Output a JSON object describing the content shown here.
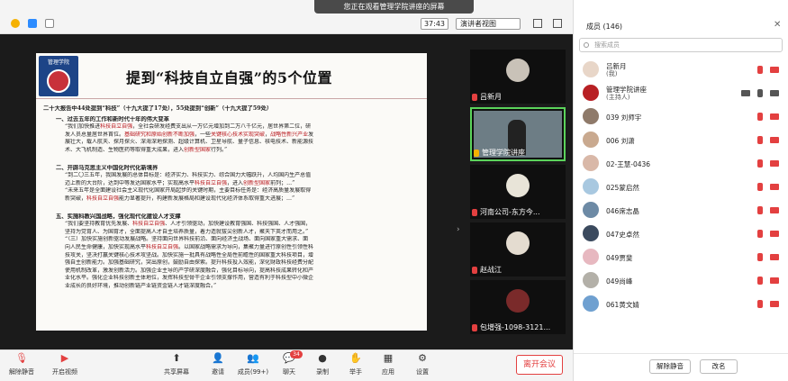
{
  "banner": "您正在观看管理学院讲座的屏幕",
  "topbar": {
    "timer": "37:43",
    "speaker_view": "演讲者视图"
  },
  "slide": {
    "logo_text": "管理学院",
    "title": "提到“科技自立自强”的5个位置",
    "lines": [
      {
        "cls": "sec",
        "text": "二十大报告中44处提到“科技”（十九大提了17处），55处提到“创新”（十九大提了59处）"
      },
      {
        "cls": "sec ind",
        "text": "一、过去五年的工作和新时代十年的伟大变革"
      },
      {
        "cls": "ind2",
        "text": "“我们加快推进科技自立自强，全社会研发经费支出从一万亿元增加到二万八千亿元，居世界第二位，研"
      },
      {
        "cls": "ind2",
        "text": "发人员总量居世界首位。基础研究和原始创新不断加强，一些关键核心技术实现突破，战略性新兴产业发"
      },
      {
        "cls": "ind2",
        "text": "展壮大，载人航天、探月探火、深海深地探测、超级计算机、卫星导航、量子信息、核电技术、新能源技"
      },
      {
        "cls": "ind2",
        "text": "术、大飞机制造、生物医药等取得重大成果，进入创新型国家行列。”"
      },
      {
        "cls": "gap",
        "text": ""
      },
      {
        "cls": "sec ind",
        "text": "二、开辟马克思主义中国化时代化新境界"
      },
      {
        "cls": "ind2",
        "text": "“到二〇三五年，我国发展的总体目标是：经济实力、科技实力、综合国力大幅跃升，人均国内生产总值"
      },
      {
        "cls": "ind2",
        "text": "迈上新的大台阶，达到中等发达国家水平；实现高水平科技自立自强，进入创新型国家前列；…”"
      },
      {
        "cls": "ind2",
        "text": "“未来五年是全面建设社会主义现代化国家开局起步的关键时期，主要目标任务是：经济高质量发展取得"
      },
      {
        "cls": "ind2",
        "text": "新突破，科技自立自强能力显著提升，构建新发展格局和建设现代化经济体系取得重大进展；…”"
      },
      {
        "cls": "gap",
        "text": ""
      },
      {
        "cls": "sec ind",
        "text": "五、实施科教兴国战略，强化现代化建设人才支撑"
      },
      {
        "cls": "ind2",
        "text": "“我们要坚持教育优先发展、科技自立自强、人才引领驱动，加快建设教育强国、科技强国、人才强国，"
      },
      {
        "cls": "ind2",
        "text": "坚持为党育人、为国育才，全面提高人才自主培养质量，着力造就拔尖创新人才，聚天下英才而用之。”"
      },
      {
        "cls": "ind2",
        "text": "“（三）加快实施创新驱动发展战略。坚持面向世界科技前沿、面向经济主战场、面向国家重大需求、面"
      },
      {
        "cls": "ind2",
        "text": "向人民生命健康，加快实现高水平科技自立自强。以国家战略需求为导向，集聚力量进行原创性引领性科"
      },
      {
        "cls": "ind2",
        "text": "技攻关，坚决打赢关键核心技术攻坚战。加快实施一批具有战略性全局性前瞻性的国家重大科技项目，增"
      },
      {
        "cls": "ind2",
        "text": "强自主创新能力。加强基础研究，突出原创，鼓励自由探索。提升科技投入效能，深化财政科技经费分配"
      },
      {
        "cls": "ind2",
        "text": "使用机制改革，激发创新活力。加强企业主导的产学研深度融合，强化目标导向，提高科技成果转化和产"
      },
      {
        "cls": "ind2",
        "text": "业化水平。强化企业科技创新主体地位，发挥科技型骨干企业引领支撑作用，营造有利于科技型中小微企"
      },
      {
        "cls": "ind2",
        "text": "业成长的良好环境，推动创新链产业链资金链人才链深度融合。”"
      }
    ]
  },
  "video_tiles": [
    {
      "name": "吕新月"
    },
    {
      "name": "管理学院讲座"
    },
    {
      "name": "河南公司-东方今..."
    },
    {
      "name": "赵战江"
    },
    {
      "name": "包增强-1098-3121..."
    }
  ],
  "toolbar": {
    "mute": "解除静音",
    "video": "开启视频",
    "share": "共享屏幕",
    "invite": "邀请",
    "participants": "成员(99+)",
    "chat": "聊天",
    "chat_badge": "34",
    "record": "录制",
    "raise_hand": "举手",
    "apps": "应用",
    "settings": "设置",
    "leave": "离开会议"
  },
  "panel": {
    "title": "成员 (146)",
    "search_placeholder": "搜索成员",
    "participants": [
      {
        "name": "吕新月",
        "sub": "(我)",
        "color": "#e8d6c8"
      },
      {
        "name": "管理学院讲座",
        "sub": "(主持人)",
        "color": "#b82024"
      },
      {
        "name": "039 刘师宇",
        "sub": "",
        "color": "#8f7a6a"
      },
      {
        "name": "006 刘潇",
        "sub": "",
        "color": "#c9a98f"
      },
      {
        "name": "02-王慧-0436",
        "sub": "",
        "color": "#d9b8a8"
      },
      {
        "name": "025蒙启然",
        "sub": "",
        "color": "#a8c8e0"
      },
      {
        "name": "046席志晶",
        "sub": "",
        "color": "#6d8aa5"
      },
      {
        "name": "047史卓然",
        "sub": "",
        "color": "#3b4a5e"
      },
      {
        "name": "049贾斐",
        "sub": "",
        "color": "#e7b8c0"
      },
      {
        "name": "049尚峰",
        "sub": "",
        "color": "#b3b0a8"
      },
      {
        "name": "061黄文婧",
        "sub": "",
        "color": "#6fa0d0"
      }
    ],
    "unmute_all": "解除静音",
    "rename": "改名"
  }
}
